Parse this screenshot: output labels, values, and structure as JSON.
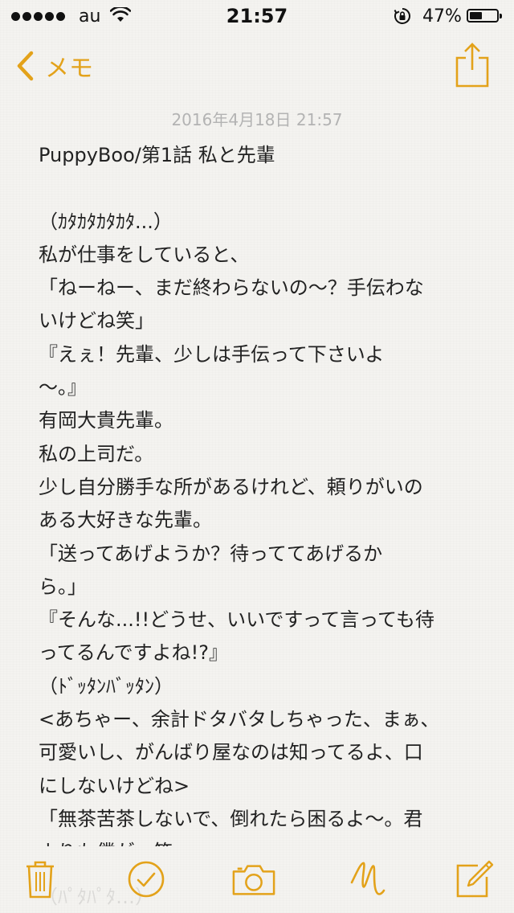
{
  "status_bar": {
    "carrier": "au",
    "time": "21:57",
    "battery_percent": "47%",
    "battery_level": 0.47,
    "icons": [
      "signal-dots-icon",
      "wifi-icon",
      "rotation-lock-icon",
      "battery-icon"
    ]
  },
  "nav": {
    "back_label": "メモ",
    "icons": [
      "chevron-left-icon",
      "share-icon"
    ]
  },
  "note": {
    "date": "2016年4月18日 21:57",
    "lines": [
      "PuppyBoo/第1話 私と先輩",
      "",
      "（ｶﾀｶﾀｶﾀｶﾀ...）",
      "私が仕事をしていると、",
      "「ねーねー、まだ終わらないの〜？手伝わな",
      "いけどね笑」",
      "『えぇ！先輩、少しは手伝って下さいよ",
      "〜。』",
      "有岡大貴先輩。",
      "私の上司だ。",
      "少し自分勝手な所があるけれど、頼りがいの",
      "ある大好きな先輩。",
      "「送ってあげようか？待っててあげるか",
      "ら。」",
      "『そんな...!!どうせ、いいですって言っても待",
      "ってるんですよね!?』",
      "（ﾄﾞｯﾀﾝﾊﾞｯﾀﾝ）",
      "<あちゃー、余計ドタバタしちゃった、まぁ、",
      "可愛いし、がんばり屋なのは知ってるよ、口",
      "にしないけどね>",
      "「無茶苦茶しないで、倒れたら困るよ〜。君",
      "よりも僕が。笑」"
    ]
  },
  "toolbar": {
    "icons": [
      "trash-icon",
      "checklist-icon",
      "camera-icon",
      "sketch-icon",
      "compose-icon"
    ]
  },
  "colors": {
    "accent": "#e3a21a",
    "date_text": "#b3b3b3",
    "body_text": "#222222",
    "background": "#f4f3f0"
  }
}
